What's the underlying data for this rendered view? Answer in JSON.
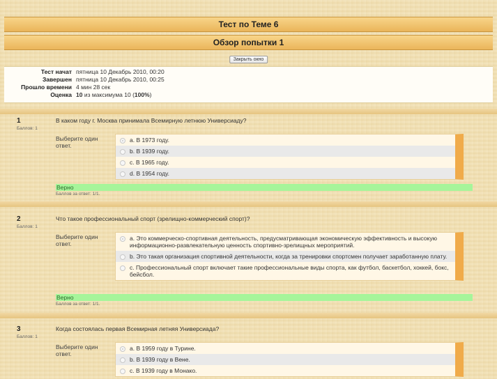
{
  "header": {
    "test_title": "Тест по Теме 6",
    "review_title": "Обзор попытки 1",
    "close_button": "Закрыть окно"
  },
  "summary": {
    "rows": [
      {
        "key": "Тест начат",
        "value": "пятница 10 Декабрь 2010, 00:20"
      },
      {
        "key": "Завершен",
        "value": "пятница 10 Декабрь 2010, 00:25"
      },
      {
        "key": "Прошло времени",
        "value": "4 мин 28 сек"
      }
    ],
    "grade_key": "Оценка",
    "grade_value": "10",
    "grade_mid": "из максимума 10 (",
    "grade_percent": "100%",
    "grade_tail": ")"
  },
  "questions": [
    {
      "num": "1",
      "points_label": "Баллов: 1",
      "text": "В каком году г. Москва принимала Всемирную летнюю Универсиаду?",
      "prompt": "Выберите один ответ.",
      "options": [
        "a. В 1973 году.",
        "b. В 1939 году.",
        "c. В 1965 году.",
        "d. В 1954 году."
      ],
      "selected": 0,
      "verdict": "Верно",
      "score": "Баллов за ответ: 1/1."
    },
    {
      "num": "2",
      "points_label": "Баллов: 1",
      "text": "Что такое профессиональный спорт (зрелищно-коммерческий спорт)?",
      "prompt": "Выберите один ответ.",
      "options": [
        "a. Это коммерческо-спортивная деятельность, предусматривающая экономическую эффективность и высокую информационно-развлекательную ценность спортивно-зрелищных мероприятий.",
        "b. Это такая организация спортивной деятельности, когда за тренировки спортсмен получает заработанную плату.",
        "c. Профессиональный спорт включает такие профессиональные виды спорта, как футбол, баскетбол, хоккей, бокс, бейсбол."
      ],
      "selected": 0,
      "verdict": "Верно",
      "score": "Баллов за ответ: 1/1."
    },
    {
      "num": "3",
      "points_label": "Баллов: 1",
      "text": "Когда состоялась первая Всемирная летняя Универсиада?",
      "prompt": "Выберите один ответ.",
      "options": [
        "a. В 1959 году в Турине.",
        "b. В 1939 году в Вене.",
        "c. В 1939 году в Монако."
      ],
      "selected": 0
    }
  ]
}
